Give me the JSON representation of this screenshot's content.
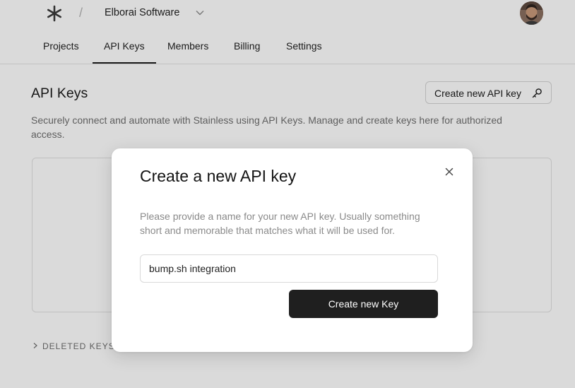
{
  "header": {
    "org_name": "Elborai Software",
    "separator": "/",
    "logo_icon": "asterisk-logo-icon",
    "avatar_icon": "user-avatar"
  },
  "tabs": [
    {
      "label": "Projects",
      "active": false
    },
    {
      "label": "API Keys",
      "active": true
    },
    {
      "label": "Members",
      "active": false
    },
    {
      "label": "Billing",
      "active": false
    },
    {
      "label": "Settings",
      "active": false
    }
  ],
  "main": {
    "title": "API Keys",
    "create_button_label": "Create new API key",
    "create_button_icon": "key-icon",
    "description": "Securely connect and automate with Stainless using API Keys. Manage and create keys here for authorized access.",
    "deleted_keys_label": "DELETED KEYS"
  },
  "modal": {
    "title": "Create a new API key",
    "description": "Please provide a name for your new API key. Usually something short and memorable that matches what it will be used for.",
    "input_value": "bump.sh integration",
    "submit_label": "Create new Key",
    "close_icon": "close-icon"
  },
  "colors": {
    "primary_button": "#1f1f1f",
    "overlay": "rgba(0,0,0,0.145)"
  }
}
